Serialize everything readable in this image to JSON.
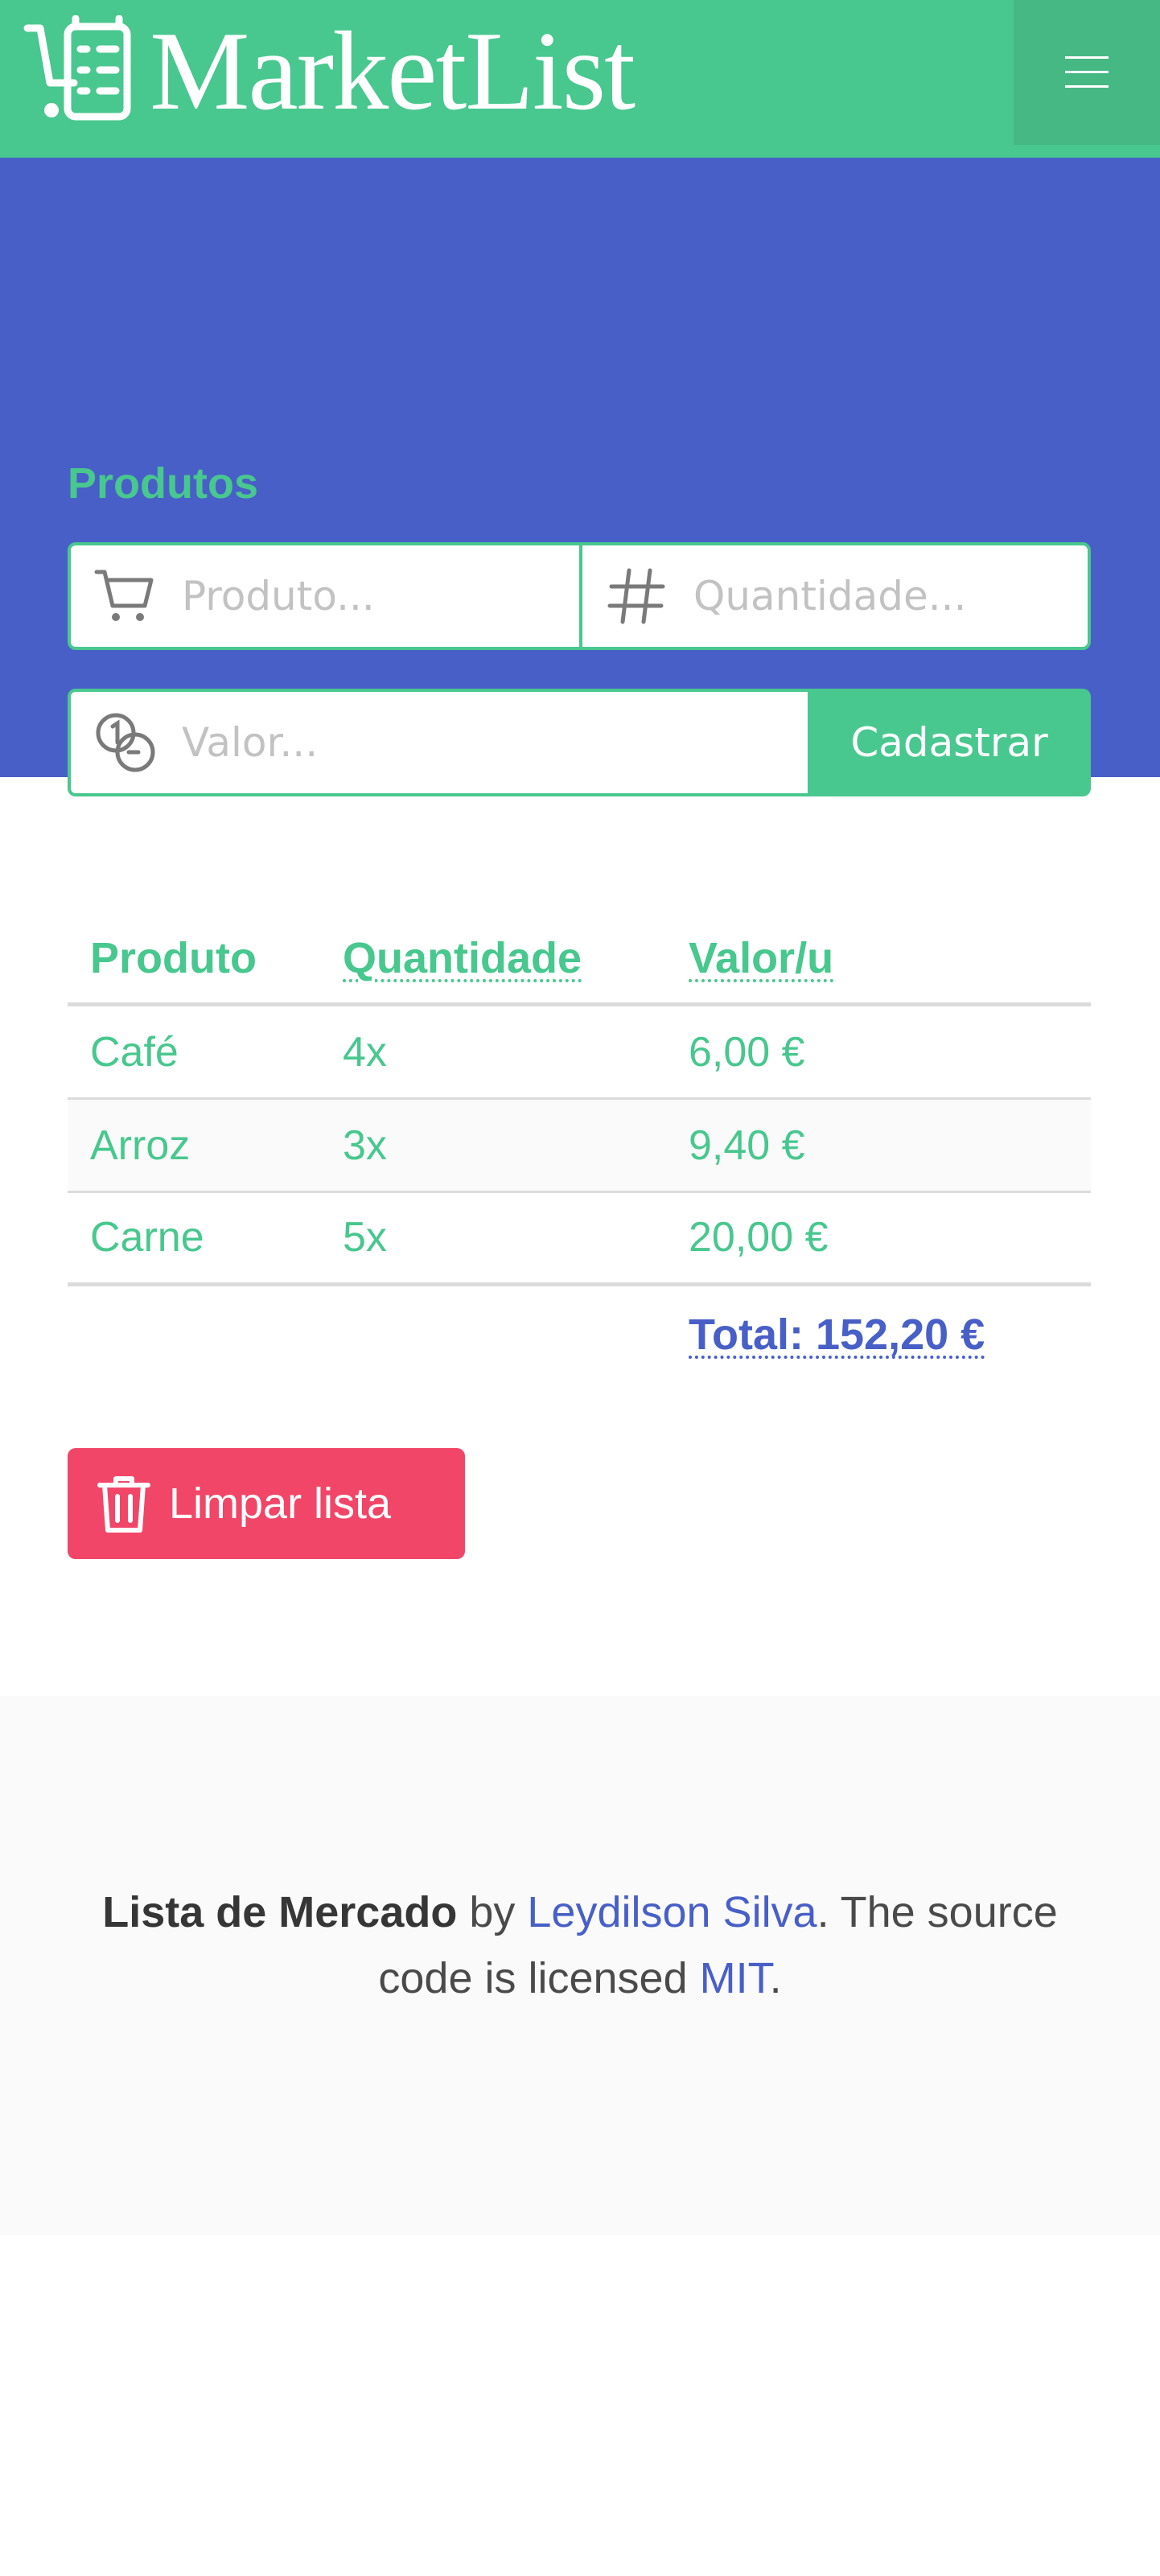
{
  "navbar": {
    "brand_name": "MarketList",
    "icons": {
      "logo": "cart-list-icon",
      "menu": "hamburger-menu-icon"
    }
  },
  "form": {
    "title": "Produtos",
    "produto_placeholder": "Produto...",
    "quantidade_placeholder": "Quantidade...",
    "valor_placeholder": "Valor...",
    "submit_label": "Cadastrar",
    "icons": {
      "produto": "cart-icon",
      "quantidade": "hash-icon",
      "valor": "coins-icon"
    }
  },
  "table": {
    "headers": [
      "Produto",
      "Quantidade",
      "Valor/u"
    ],
    "rows": [
      {
        "produto": "Café",
        "quantidade": "4x",
        "valor": "6,00 €"
      },
      {
        "produto": "Arroz",
        "quantidade": "3x",
        "valor": "9,40 €"
      },
      {
        "produto": "Carne",
        "quantidade": "5x",
        "valor": "20,00 €"
      }
    ],
    "total": "Total: 152,20 €"
  },
  "actions": {
    "clear_label": "Limpar lista",
    "clear_icon": "trash-icon"
  },
  "footer": {
    "project": "Lista de Mercado",
    "by": " by ",
    "author": "Leydilson Silva",
    "middle": ". The source code is licensed ",
    "license": "MIT",
    "end": "."
  },
  "colors": {
    "primary_green": "#48c78e",
    "hero_blue": "#485fc7",
    "danger": "#f14668",
    "footer_bg": "#fafafa"
  }
}
